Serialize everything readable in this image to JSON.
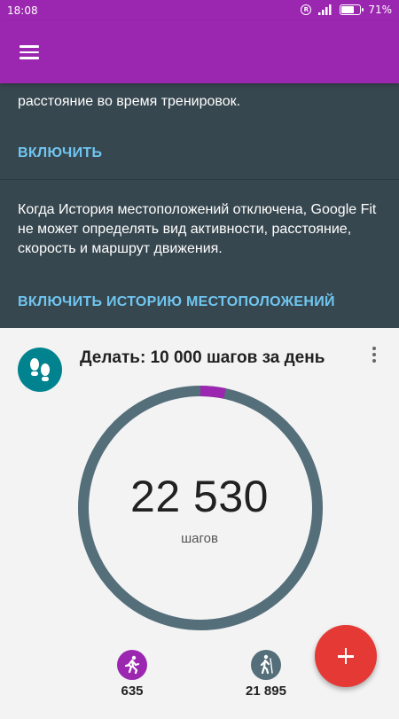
{
  "status_bar": {
    "time": "18:08",
    "battery": "71%",
    "battery_level": 0.71,
    "icons": [
      "registered-icon",
      "signal-icon",
      "battery-icon"
    ]
  },
  "app_bar": {
    "color": "#9b27b0",
    "menu_icon": "menu-icon"
  },
  "info_cards": {
    "partial_text": "расстояние во время тренировок.",
    "enable_label": "ВКЛЮЧИТЬ",
    "location_text": "Когда История местоположений отключена, Google Fit не может определять вид активности, расстояние, скорость и маршрут движения.",
    "enable_location_label": "ВКЛЮЧИТЬ ИСТОРИЮ МЕСТОПОЛОЖЕНИЙ",
    "background": "#37474f",
    "action_color": "#70c6f0"
  },
  "goal_card": {
    "icon": "footsteps-icon",
    "title": "Делать: 10 000 шагов за день",
    "steps_value": "22 530",
    "steps_unit": "шагов",
    "ring_color": "#546e7a",
    "progress_color": "#9b27b0",
    "goal_steps": 10000,
    "steps": 22530,
    "more_icon": "more-vert-icon",
    "activities": [
      {
        "icon": "running-icon",
        "value": "635",
        "color": "#9b27b0"
      },
      {
        "icon": "walking-icon",
        "value": "21 895",
        "color": "#546e7a"
      }
    ]
  },
  "fab": {
    "icon": "plus-icon",
    "color": "#e53935"
  }
}
